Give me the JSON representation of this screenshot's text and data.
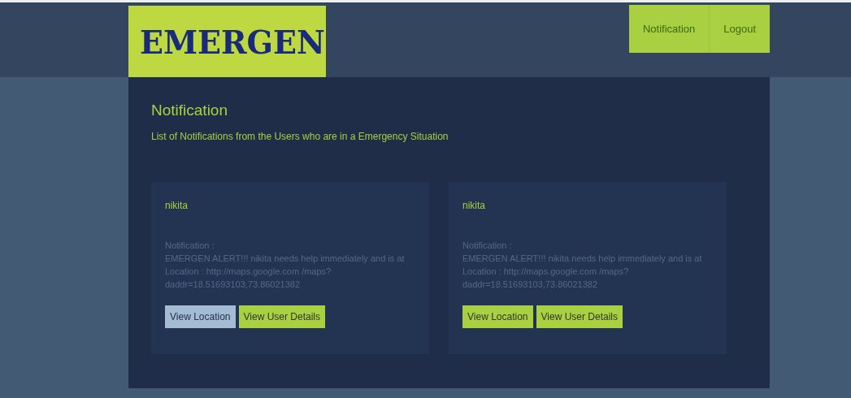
{
  "logo": {
    "text": "EMERGEN"
  },
  "nav": [
    {
      "label": "Notification"
    },
    {
      "label": "Logout"
    }
  ],
  "page": {
    "title": "Notification",
    "subtitle": "List of Notifications from the Users who are in a Emergency Situation"
  },
  "notifications": [
    {
      "user": "nikita",
      "label": "Notification :",
      "message": "EMERGEN ALERT!!! nikita needs help immediately and is at Location : http://maps.google.com /maps?daddr=18.51693103,73.86021382",
      "buttons": [
        {
          "label": "View Location",
          "selected": true
        },
        {
          "label": "View User Details",
          "selected": false
        }
      ]
    },
    {
      "user": "nikita",
      "label": "Notification :",
      "message": "EMERGEN ALERT!!! nikita needs help immediately and is at Location : http://maps.google.com /maps?daddr=18.51693103,73.86021382",
      "buttons": [
        {
          "label": "View Location",
          "selected": false
        },
        {
          "label": "View User Details",
          "selected": false
        }
      ]
    }
  ]
}
